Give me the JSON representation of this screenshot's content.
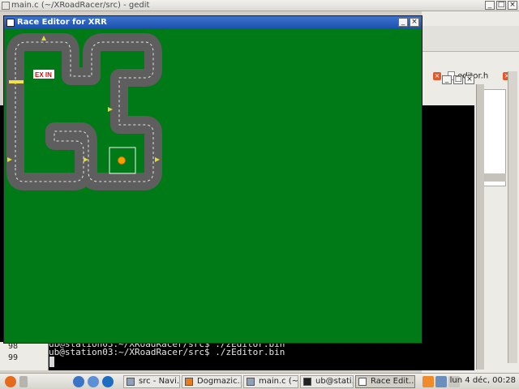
{
  "gedit": {
    "title": "main.c (~/XRoadRacer/src) - gedit",
    "tab_label": "editor.h"
  },
  "terminal": {
    "line1": "ub@station03:~/XRoadRacer/src$ ./zEditor.bin",
    "line2": "ub@station03:~/XRoadRacer/src$ ./zEditor.bin",
    "line_nums": [
      "98",
      "99"
    ]
  },
  "race_editor": {
    "title": "Race Editor for XRR",
    "finish_label": "EX IN"
  },
  "taskbar": {
    "items": [
      {
        "label": "src - Navi...",
        "active": false
      },
      {
        "label": "Dogmazic...",
        "active": false
      },
      {
        "label": "main.c (~...",
        "active": false
      },
      {
        "label": "ub@stati...",
        "active": false
      },
      {
        "label": "Race Edit...",
        "active": true
      }
    ],
    "clock": "lun 4 déc, 00:28"
  },
  "colors": {
    "editor_bg": "#007a17",
    "road": "#5e5e5e",
    "road_edge": "#e6e6e6",
    "titlebar": "#2a5fbe"
  },
  "icons": [
    "close-icon",
    "minimize-icon",
    "maximize-icon",
    "file-icon",
    "firefox-icon",
    "terminal-icon",
    "folder-icon",
    "settings-icon"
  ]
}
